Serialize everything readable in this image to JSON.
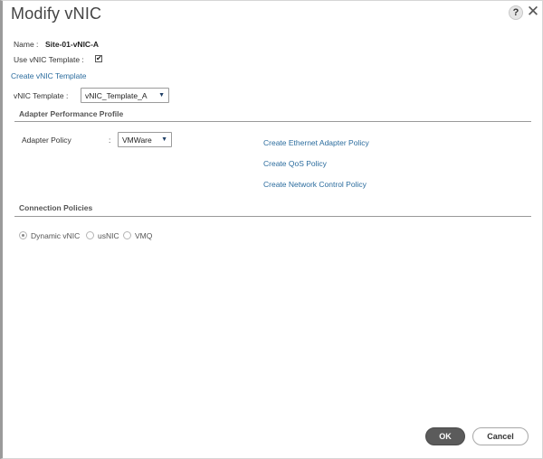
{
  "dialog": {
    "title": "Modify vNIC",
    "help_symbol": "?",
    "close_symbol": "✕"
  },
  "fields": {
    "name_label": "Name :",
    "name_value": "Site-01-vNIC-A",
    "use_template_label": "Use vNIC Template :",
    "use_template_checked": true,
    "create_template_link": "Create vNIC Template",
    "vnic_template_label": "vNIC Template :",
    "vnic_template_value": "vNIC_Template_A"
  },
  "adapter_section": {
    "heading": "Adapter Performance Profile",
    "policy_label": "Adapter Policy",
    "policy_colon": ":",
    "policy_value": "VMWare",
    "links": [
      "Create Ethernet Adapter Policy",
      "Create QoS Policy",
      "Create Network Control Policy"
    ]
  },
  "connection_section": {
    "heading": "Connection Policies",
    "options": [
      {
        "label": "Dynamic vNIC",
        "selected": true
      },
      {
        "label": "usNIC",
        "selected": false
      },
      {
        "label": "VMQ",
        "selected": false
      }
    ]
  },
  "footer": {
    "ok_label": "OK",
    "cancel_label": "Cancel"
  },
  "icons": {
    "help": "help-icon",
    "close": "close-icon",
    "dropdown": "chevron-down-icon",
    "check": "checkmark-icon"
  }
}
